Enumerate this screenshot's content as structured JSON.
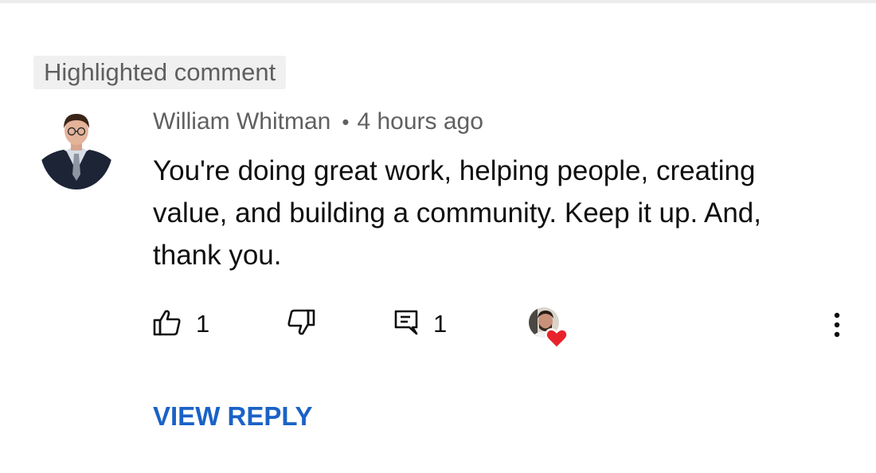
{
  "badge": {
    "label": "Highlighted comment"
  },
  "comment": {
    "author": "William Whitman",
    "separator": "•",
    "timestamp": "4 hours ago",
    "text": "You're doing great work, helping people, creating value, and building a community. Keep it up. And, thank you."
  },
  "actions": {
    "like_count": "1",
    "reply_count": "1",
    "creator_heart": true
  },
  "icons": {
    "like": "thumbs-up-icon",
    "dislike": "thumbs-down-icon",
    "reply": "comment-icon",
    "heart": "heart-icon",
    "more": "more-vertical-icon"
  },
  "footer": {
    "view_reply_label": "VIEW REPLY"
  },
  "colors": {
    "link": "#1a62c7",
    "heart": "#e8222b",
    "muted_text": "#606060",
    "badge_bg": "#f0f0f0"
  }
}
